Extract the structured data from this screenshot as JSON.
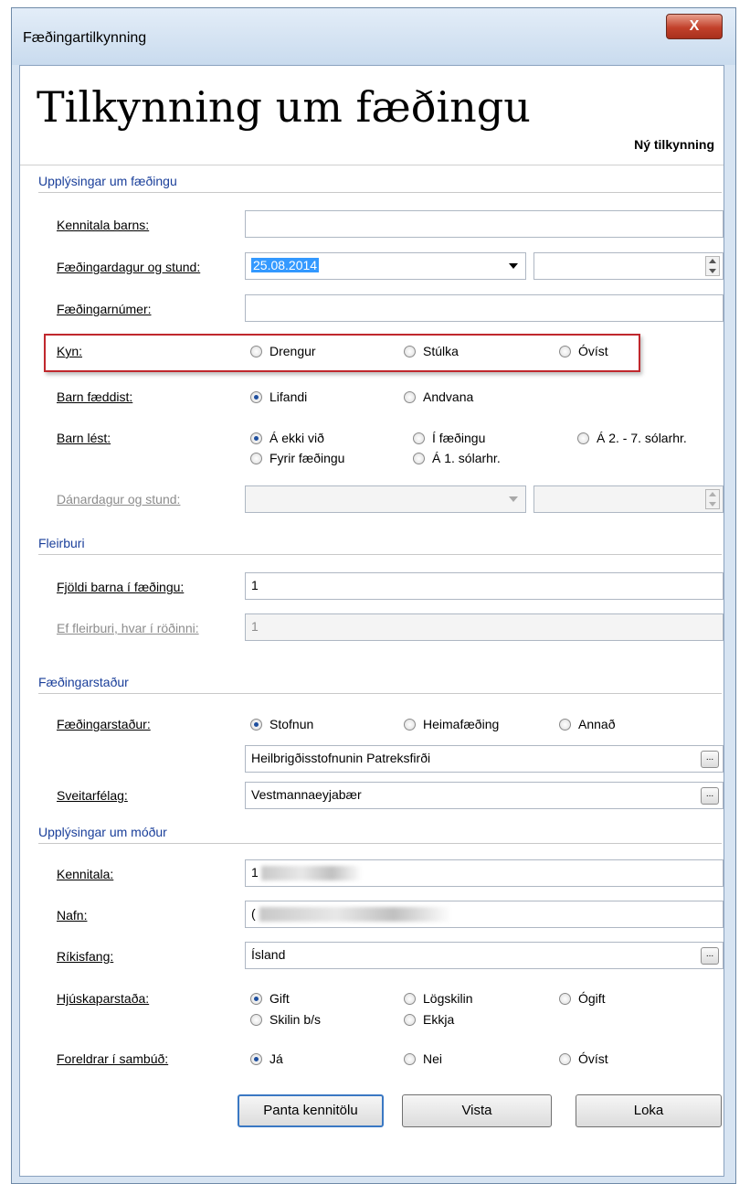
{
  "window": {
    "title": "Fæðingartilkynning",
    "close_label": "X"
  },
  "header": {
    "title": "Tilkynning um fæðingu",
    "status": "Ný tilkynning"
  },
  "birth_info": {
    "section": "Upplýsingar um fæðingu",
    "child_id_label": "Kennitala barns:",
    "child_id_value": "",
    "birth_datetime_label": "Fæðingardagur og stund:",
    "birth_date_value": "25.08.2014",
    "birth_time_value": "",
    "birth_number_label": "Fæðingarnúmer:",
    "birth_number_value": "",
    "sex_label": "Kyn:",
    "sex_options": [
      "Drengur",
      "Stúlka",
      "Óvíst"
    ],
    "born_label": "Barn fæddist:",
    "born_options": [
      "Lifandi",
      "Andvana"
    ],
    "died_label": "Barn lést:",
    "died_options": [
      "Á ekki við",
      "Í fæðingu",
      "Á 2. - 7. sólarhr.",
      "Fyrir fæðingu",
      "Á 1. sólarhr."
    ],
    "death_datetime_label": "Dánardagur og stund:"
  },
  "multiples": {
    "section": "Fleirburi",
    "count_label": "Fjöldi barna í fæðingu:",
    "count_value": "1",
    "order_label": "Ef fleirburi, hvar í röðinni:",
    "order_value": "1"
  },
  "birthplace": {
    "section": "Fæðingarstaður",
    "place_label": "Fæðingarstaður:",
    "place_options": [
      "Stofnun",
      "Heimafæðing",
      "Annað"
    ],
    "institution_value": "Heilbrigðisstofnunin Patreksfirði",
    "municipality_label": "Sveitarfélag:",
    "municipality_value": "Vestmannaeyjabær"
  },
  "mother": {
    "section": "Upplýsingar um móður",
    "id_label": "Kennitala:",
    "id_value": "1",
    "name_label": "Nafn:",
    "name_value": "(",
    "citizenship_label": "Ríkisfang:",
    "citizenship_value": "Ísland",
    "marital_label": "Hjúskaparstaða:",
    "marital_options": [
      "Gift",
      "Lögskilin",
      "Ógift",
      "Skilin b/s",
      "Ekkja"
    ],
    "cohabiting_label": "Foreldrar í sambúð:",
    "cohabiting_options": [
      "Já",
      "Nei",
      "Óvíst"
    ]
  },
  "buttons": {
    "order_id": "Panta kennitölu",
    "view": "Vista",
    "close": "Loka"
  },
  "ellipsis": "..."
}
